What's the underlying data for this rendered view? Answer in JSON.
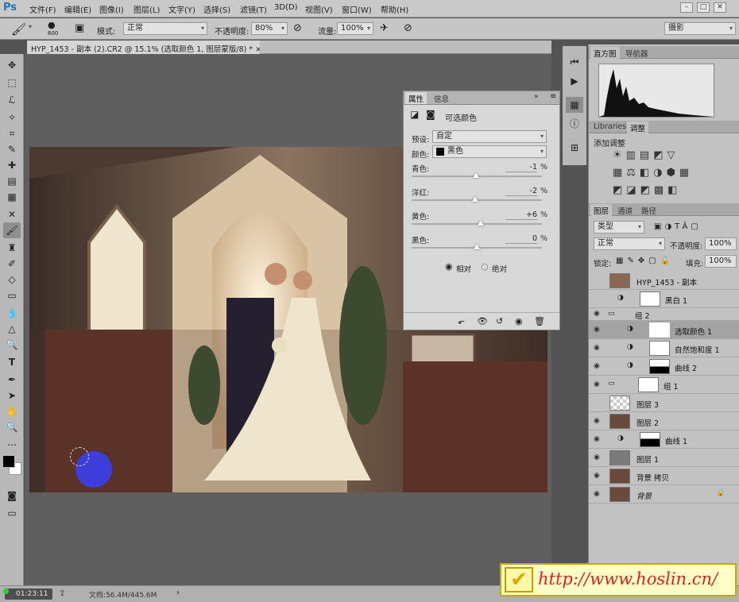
{
  "app": {
    "logo": "Ps"
  },
  "menu": [
    "文件(F)",
    "编辑(E)",
    "图像(I)",
    "图层(L)",
    "文字(Y)",
    "选择(S)",
    "滤镜(T)",
    "3D(D)",
    "视图(V)",
    "窗口(W)",
    "帮助(H)"
  ],
  "window_controls": {
    "minimize": "–",
    "restore": "□",
    "close": "✕"
  },
  "options": {
    "brush_size": "600",
    "mode_label": "模式:",
    "mode_value": "正常",
    "opacity_label": "不透明度:",
    "opacity_value": "80%",
    "flow_label": "流量:",
    "flow_value": "100%",
    "workspace": "摄影"
  },
  "document": {
    "tab_title": "HYP_1453 - 副本 (2).CR2 @ 15.1% (选取颜色 1, 图层蒙版/8) *",
    "tab_close": "×"
  },
  "status": {
    "timer": "01:23:11",
    "docsize": "文档:56.4M/445.6M"
  },
  "watermark": {
    "text": "http://www.hoslin.cn/"
  },
  "panels": {
    "top_tabs": [
      "直方图",
      "导航器"
    ],
    "mid_tabs": [
      "Libraries",
      "调整"
    ],
    "adjust_title": "添加调整",
    "layer_tabs": [
      "图层",
      "通道",
      "路径"
    ],
    "layer_kind": "类型",
    "blend_mode": "正常",
    "opacity_label": "不透明度:",
    "opacity_value": "100%",
    "lock_label": "锁定:",
    "fill_label": "填充:",
    "fill_value": "100%"
  },
  "layers": [
    {
      "name": "HYP_1453 - 副本",
      "visible": false,
      "type": "photo"
    },
    {
      "name": "黑白 1",
      "visible": false,
      "type": "adjust"
    },
    {
      "name": "组 2",
      "visible": true,
      "type": "group"
    },
    {
      "name": "选取颜色 1",
      "visible": true,
      "type": "adjust",
      "selected": true
    },
    {
      "name": "自然饱和度 1",
      "visible": true,
      "type": "adjust"
    },
    {
      "name": "曲线 2",
      "visible": true,
      "type": "adjust"
    },
    {
      "name": "组 1",
      "visible": true,
      "type": "group"
    },
    {
      "name": "图层 3",
      "visible": false,
      "type": "transparent"
    },
    {
      "name": "图层 2",
      "visible": true,
      "type": "photo"
    },
    {
      "name": "曲线 1",
      "visible": true,
      "type": "adjust"
    },
    {
      "name": "图层 1",
      "visible": true,
      "type": "gray"
    },
    {
      "name": "背景 拷贝",
      "visible": true,
      "type": "photo"
    },
    {
      "name": "背景",
      "visible": true,
      "type": "photo",
      "locked": true
    }
  ],
  "properties": {
    "tabs": [
      "属性",
      "信息"
    ],
    "title": "可选颜色",
    "preset_label": "预设:",
    "preset_value": "自定",
    "color_label": "颜色:",
    "color_value": "黑色",
    "sliders": [
      {
        "label": "青色:",
        "value": "-1",
        "position": 0.495
      },
      {
        "label": "洋红:",
        "value": "-2",
        "position": 0.49
      },
      {
        "label": "黄色:",
        "value": "+6",
        "position": 0.53
      },
      {
        "label": "黑色:",
        "value": "0",
        "position": 0.5
      }
    ],
    "radio_relative": "相对",
    "radio_absolute": "绝对",
    "percent": "%"
  },
  "colors": {
    "foreground": "#000000",
    "background": "#ffffff",
    "brush_preview": "#3d3ddb"
  }
}
